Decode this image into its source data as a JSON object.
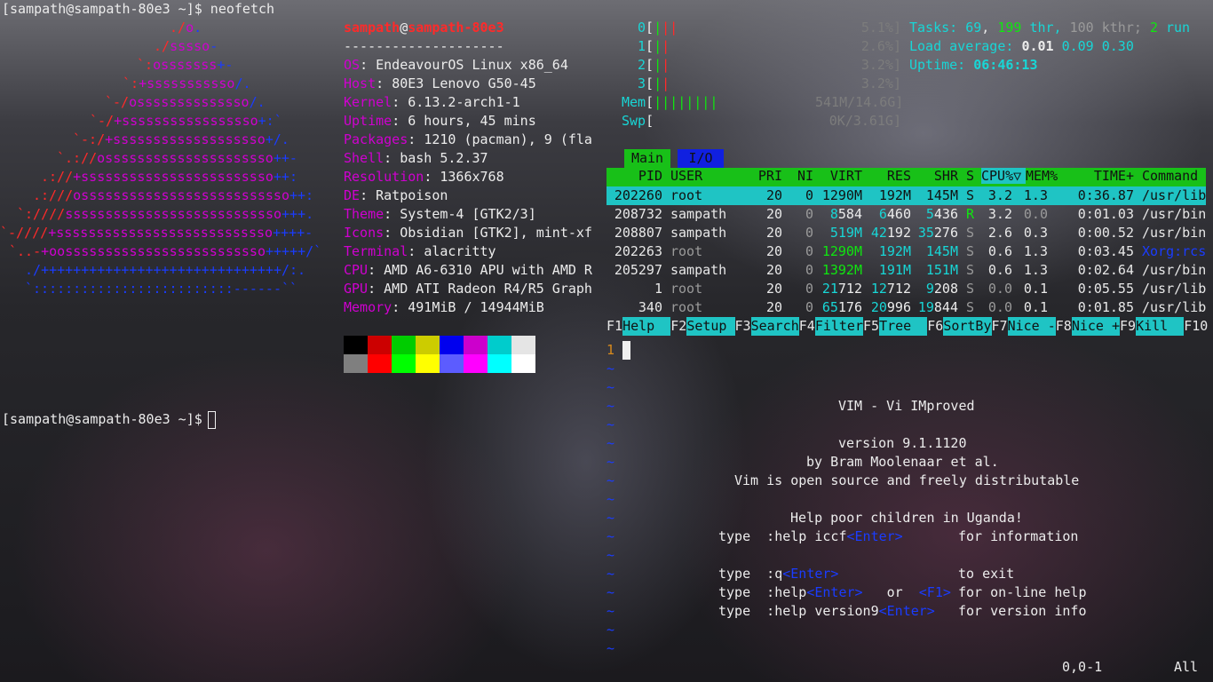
{
  "terminal_left": {
    "prompt1": "[sampath@sampath-80e3 ~]$ neofetch",
    "prompt2": "[sampath@sampath-80e3 ~]$ ",
    "logo_lines": [
      "./o.",
      "./sssso-",
      "`:osssssss+-",
      "`:+sssssssssso/.",
      "`-/ossssssssssssso/.",
      "`-/+sssssssssssssssso+:`",
      "`-:/+sssssssssssssssssso+/.",
      "`.://osssssssssssssssssssso++-",
      ".://+ssssssssssssssssssssssso++:",
      ".:///ossssssssssssssssssssssssso++:",
      "`:////sssssssssssssssssssssssssso+++.",
      "`-////+sssssssssssssssssssssssssso++++-",
      "`..-+oosssssssssssssssssssssssso+++++/`",
      "./++++++++++++++++++++++++++++++/:.",
      "`:::::::::::::::::::::::::------``"
    ],
    "user": "sampath",
    "at": "@",
    "host": "sampath-80e3",
    "separator": "--------------------",
    "info": [
      {
        "key": "OS",
        "value": "EndeavourOS Linux x86_64"
      },
      {
        "key": "Host",
        "value": "80E3 Lenovo G50-45"
      },
      {
        "key": "Kernel",
        "value": "6.13.2-arch1-1"
      },
      {
        "key": "Uptime",
        "value": "6 hours, 45 mins"
      },
      {
        "key": "Packages",
        "value": "1210 (pacman), 9 (fla"
      },
      {
        "key": "Shell",
        "value": "bash 5.2.37"
      },
      {
        "key": "Resolution",
        "value": "1366x768"
      },
      {
        "key": "DE",
        "value": "Ratpoison"
      },
      {
        "key": "Theme",
        "value": "System-4 [GTK2/3]"
      },
      {
        "key": "Icons",
        "value": "Obsidian [GTK2], mint-xf"
      },
      {
        "key": "Terminal",
        "value": "alacritty"
      },
      {
        "key": "CPU",
        "value": "AMD A6-6310 APU with AMD R"
      },
      {
        "key": "GPU",
        "value": "AMD ATI Radeon R4/R5 Graph"
      },
      {
        "key": "Memory",
        "value": "491MiB / 14944MiB"
      }
    ],
    "colors_dark": [
      "#000000",
      "#cc0000",
      "#00cc00",
      "#cccc00",
      "#0000ee",
      "#cc00cc",
      "#00cccc",
      "#e5e5e5"
    ],
    "colors_bright": [
      "#7f7f7f",
      "#ff0000",
      "#00ff00",
      "#ffff00",
      "#5c5cff",
      "#ff00ff",
      "#00ffff",
      "#ffffff"
    ]
  },
  "htop": {
    "cpus": [
      {
        "id": "0",
        "bars": "|||",
        "pct": "5.1%]"
      },
      {
        "id": "1",
        "bars": "||",
        "pct": "2.6%]"
      },
      {
        "id": "2",
        "bars": "||",
        "pct": "3.2%]"
      },
      {
        "id": "3",
        "bars": "||",
        "pct": "3.2%]"
      }
    ],
    "mem": {
      "label": "Mem",
      "bars": "||||||||",
      "value": "541M/14.6G]"
    },
    "swp": {
      "label": "Swp",
      "value": "0K/3.61G]"
    },
    "tasks": {
      "label": "Tasks:",
      "count": "69",
      "thr": "199",
      "thr_label": "thr,",
      "kthr": "100 kthr;",
      "run": "2",
      "run_label": "run"
    },
    "load": {
      "label": "Load average:",
      "v1": "0.01",
      "v2": "0.09",
      "v3": "0.30"
    },
    "uptime": {
      "label": "Uptime:",
      "value": "06:46:13"
    },
    "tabs": {
      "main": "Main",
      "io": "I/O"
    },
    "columns": [
      "PID",
      "USER",
      "PRI",
      "NI",
      "VIRT",
      "RES",
      "SHR",
      "S",
      "CPU%▽",
      "MEM%",
      "TIME+",
      "Command"
    ],
    "processes": [
      {
        "pid": "202260",
        "user": "root",
        "pri": "20",
        "ni": "0",
        "virt": "1290M",
        "res": "192M",
        "shr": "145M",
        "s": "S",
        "cpu": "3.2",
        "mem": "1.3",
        "time": "0:36.87",
        "cmd": "/usr/lib"
      },
      {
        "pid": "208732",
        "user": "sampath",
        "pri": "20",
        "ni": "0",
        "virt": "8584",
        "res": "6460",
        "shr": "5436",
        "s": "R",
        "cpu": "3.2",
        "mem": "0.0",
        "time": "0:01.03",
        "cmd": "/usr/bin"
      },
      {
        "pid": "208807",
        "user": "sampath",
        "pri": "20",
        "ni": "0",
        "virt": "519M",
        "res": "42192",
        "shr": "35276",
        "s": "S",
        "cpu": "2.6",
        "mem": "0.3",
        "time": "0:00.52",
        "cmd": "/usr/bin"
      },
      {
        "pid": "202263",
        "user": "root",
        "pri": "20",
        "ni": "0",
        "virt": "1290M",
        "res": "192M",
        "shr": "145M",
        "s": "S",
        "cpu": "0.6",
        "mem": "1.3",
        "time": "0:03.45",
        "cmd": "Xorg:rcs"
      },
      {
        "pid": "205297",
        "user": "sampath",
        "pri": "20",
        "ni": "0",
        "virt": "1392M",
        "res": "191M",
        "shr": "151M",
        "s": "S",
        "cpu": "0.6",
        "mem": "1.3",
        "time": "0:02.64",
        "cmd": "/usr/bin"
      },
      {
        "pid": "1",
        "user": "root",
        "pri": "20",
        "ni": "0",
        "virt": "21712",
        "res": "12712",
        "shr": "9208",
        "s": "S",
        "cpu": "0.0",
        "mem": "0.1",
        "time": "0:05.55",
        "cmd": "/usr/lib"
      },
      {
        "pid": "340",
        "user": "root",
        "pri": "20",
        "ni": "0",
        "virt": "65176",
        "res": "20996",
        "shr": "19844",
        "s": "S",
        "cpu": "0.0",
        "mem": "0.1",
        "time": "0:01.85",
        "cmd": "/usr/lib"
      }
    ],
    "fkeys": [
      {
        "key": "F1",
        "label": "Help  "
      },
      {
        "key": "F2",
        "label": "Setup "
      },
      {
        "key": "F3",
        "label": "Search"
      },
      {
        "key": "F4",
        "label": "Filter"
      },
      {
        "key": "F5",
        "label": "Tree  "
      },
      {
        "key": "F6",
        "label": "SortBy"
      },
      {
        "key": "F7",
        "label": "Nice -"
      },
      {
        "key": "F8",
        "label": "Nice +"
      },
      {
        "key": "F9",
        "label": "Kill  "
      },
      {
        "key": "F10",
        "label": ""
      }
    ]
  },
  "vim": {
    "line_number": "1",
    "tilde": "~",
    "title": "VIM - Vi IMproved",
    "version": "version 9.1.1120",
    "author": "by Bram Moolenaar et al.",
    "license": "Vim is open source and freely distributable",
    "charity": "Help poor children in Uganda!",
    "help_lines": [
      {
        "type": "type",
        "cmd": ":help iccf",
        "key": "<Enter>",
        "mid": "",
        "key2": "",
        "desc": "for information"
      },
      {
        "type": "type",
        "cmd": ":q",
        "key": "<Enter>",
        "mid": "",
        "key2": "",
        "desc": "to exit"
      },
      {
        "type": "type",
        "cmd": ":help",
        "key": "<Enter>",
        "mid": "or",
        "key2": "<F1>",
        "desc": "for on-line help"
      },
      {
        "type": "type",
        "cmd": ":help version9",
        "key": "<Enter>",
        "mid": "",
        "key2": "",
        "desc": "for version info"
      }
    ],
    "ruler": "0,0-1",
    "position": "All"
  }
}
